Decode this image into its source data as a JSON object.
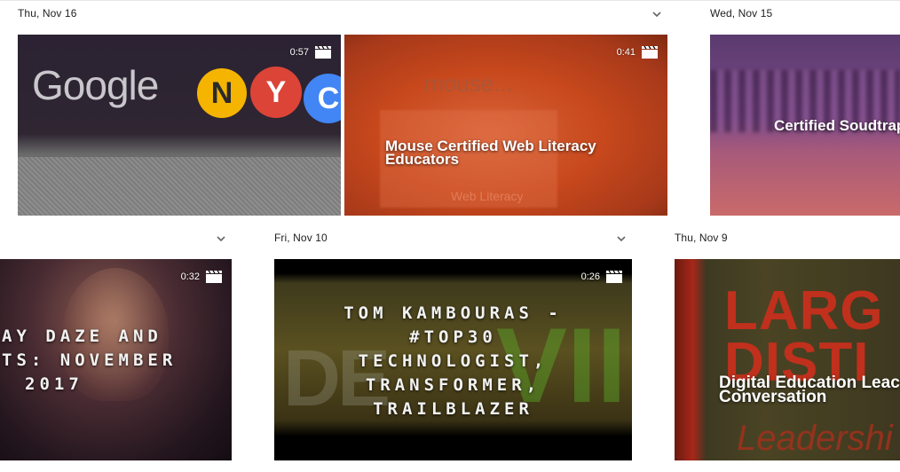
{
  "sections": [
    {
      "date": "Thu, Nov 16"
    },
    {
      "date": "Wed, Nov 15"
    },
    {
      "date": "Fri, Nov 10"
    },
    {
      "date": "Thu, Nov 9"
    }
  ],
  "tiles": {
    "google_nyc": {
      "duration": "0:57",
      "bg_text": "Google",
      "letters": [
        "N",
        "Y",
        "C"
      ],
      "icon": "video-clip-icon"
    },
    "mouse": {
      "duration": "0:41",
      "title": "Mouse  Certified Web Literacy Educators",
      "bg_top": "mouse...",
      "bg_bottom": "Web Literacy",
      "icon": "video-clip-icon"
    },
    "soudtrap": {
      "title": "Certified Soudtrap"
    },
    "holiday": {
      "duration": "0:32",
      "lines": [
        "AY DAZE AND",
        "TS: NOVEMBER",
        "2017"
      ],
      "icon": "video-clip-icon"
    },
    "tom": {
      "duration": "0:26",
      "lines": [
        "TOM KAMBOURAS -",
        "#TOP30",
        "TECHNOLOGIST,",
        "TRANSFORMER,",
        "TRAILBLAZER"
      ],
      "icon": "video-clip-icon"
    },
    "digital": {
      "title": "Digital Education Leac Conversation",
      "bg_big": "LARG DISTI",
      "bg_small": "Leadershi"
    }
  },
  "colors": {
    "accent_blue": "#4285f4",
    "google_yellow": "#f4b400",
    "google_red": "#db4437",
    "orange_tile": "#c7481c",
    "red_tile": "#c0301c"
  }
}
